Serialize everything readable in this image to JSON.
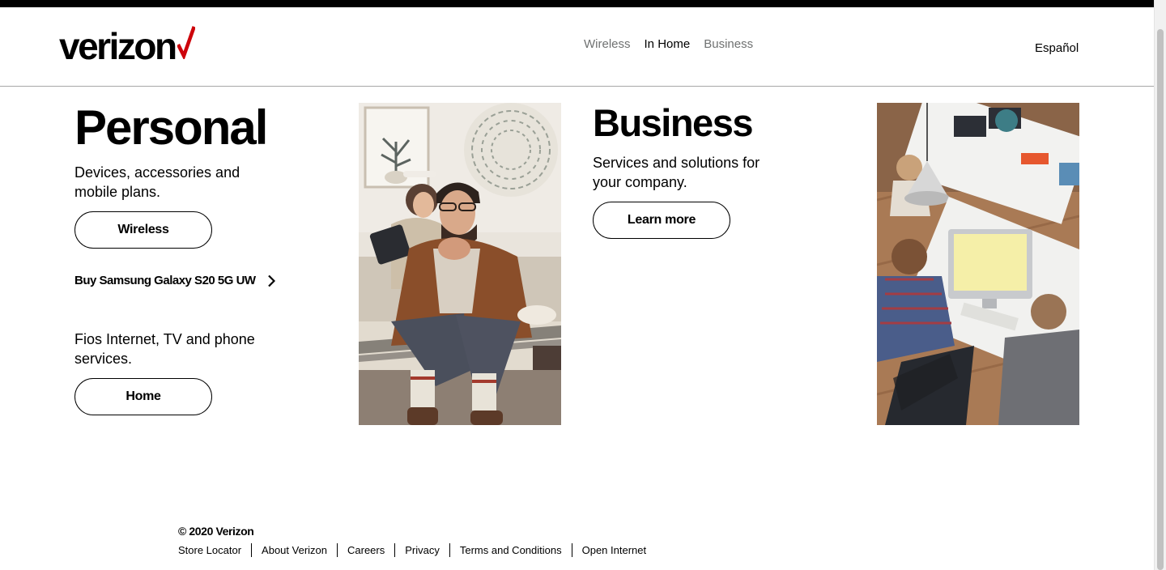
{
  "brand": {
    "logo_text": "verizon",
    "accent_color": "#cd040b"
  },
  "nav": {
    "links": [
      {
        "label": "Wireless",
        "active": false
      },
      {
        "label": "In Home",
        "active": true
      },
      {
        "label": "Business",
        "active": false
      }
    ],
    "language_label": "Español"
  },
  "personal": {
    "title": "Personal",
    "wireless_desc": "Devices, accessories and mobile plans.",
    "wireless_button": "Wireless",
    "promo_link": "Buy Samsung Galaxy S20 5G UW",
    "home_desc": "Fios Internet, TV and phone services.",
    "home_button": "Home"
  },
  "business": {
    "title": "Business",
    "desc": "Services and solutions for your company.",
    "button": "Learn more"
  },
  "footer": {
    "copyright": "© 2020 Verizon",
    "links": [
      "Store Locator",
      "About Verizon",
      "Careers",
      "Privacy",
      "Terms and Conditions",
      "Open Internet"
    ]
  }
}
